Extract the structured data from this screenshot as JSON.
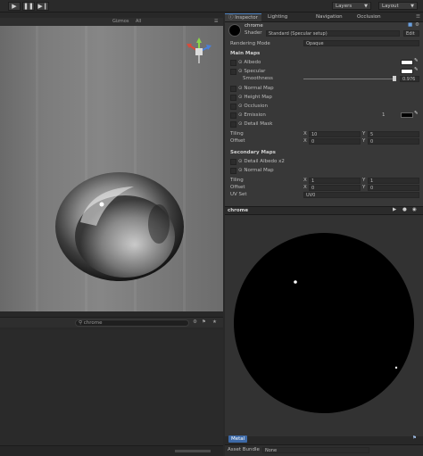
{
  "toolbar": {
    "play_icon": "play-icon",
    "pause_icon": "pause-icon",
    "step_icon": "step-icon",
    "layers_label": "Layers",
    "layout_label": "Layout"
  },
  "scene": {
    "gizmos_label": "Gizmos",
    "search_placeholder": "All"
  },
  "project": {
    "search_value": "chrome"
  },
  "inspector": {
    "tabs": [
      "Inspector",
      "Lighting",
      "Navigation",
      "Occlusion"
    ],
    "material_name": "chrome",
    "shader_label": "Shader",
    "shader_value": "Standard (Specular setup)",
    "edit_label": "Edit",
    "rendering_mode_label": "Rendering Mode",
    "rendering_mode_value": "Opaque",
    "main_maps_label": "Main Maps",
    "albedo_label": "Albedo",
    "specular_label": "Specular",
    "smoothness_label": "Smoothness",
    "smoothness_value": "0.976",
    "normal_map_label": "Normal Map",
    "height_map_label": "Height Map",
    "occlusion_label": "Occlusion",
    "emission_label": "Emission",
    "emission_value": "1",
    "detail_mask_label": "Detail Mask",
    "tiling_label": "Tiling",
    "offset_label": "Offset",
    "tiling_x": "10",
    "tiling_y": "5",
    "offset_x": "0",
    "offset_y": "0",
    "secondary_maps_label": "Secondary Maps",
    "detail_albedo_label": "Detail Albedo x2",
    "detail_normal_label": "Normal Map",
    "sec_tiling_x": "1",
    "sec_tiling_y": "1",
    "sec_offset_x": "0",
    "sec_offset_y": "0",
    "uv_set_label": "UV Set",
    "uv_set_value": "UV0",
    "colors": {
      "albedo": "#ffffff",
      "specular": "#ffffff",
      "emission": "#000000"
    }
  },
  "preview": {
    "title": "chrome",
    "badge": "Metal",
    "asset_bundle_label": "Asset Bundle",
    "asset_bundle_value": "None"
  }
}
